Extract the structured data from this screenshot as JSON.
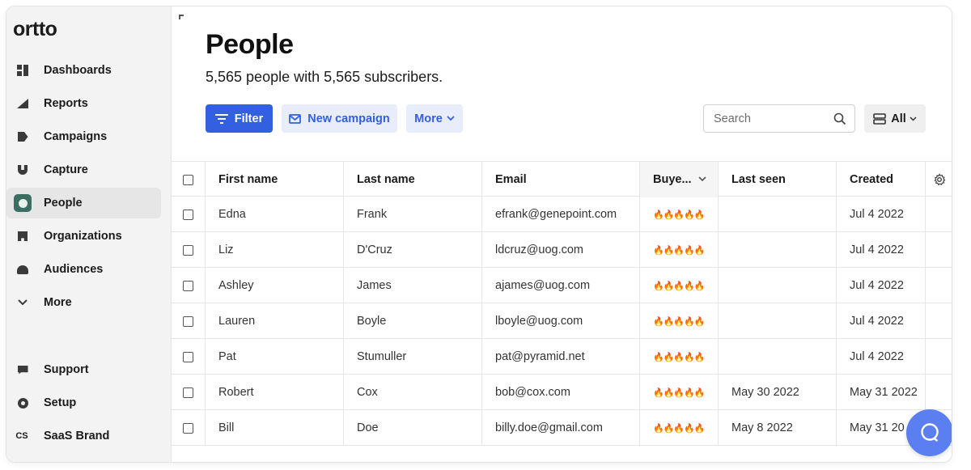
{
  "app": {
    "logo": "ortto"
  },
  "sidebar": {
    "items": [
      {
        "label": "Dashboards",
        "icon": "dashboard-icon"
      },
      {
        "label": "Reports",
        "icon": "reports-icon"
      },
      {
        "label": "Campaigns",
        "icon": "campaigns-icon"
      },
      {
        "label": "Capture",
        "icon": "capture-icon"
      },
      {
        "label": "People",
        "icon": "people-icon",
        "active": true
      },
      {
        "label": "Organizations",
        "icon": "organizations-icon"
      },
      {
        "label": "Audiences",
        "icon": "audiences-icon"
      },
      {
        "label": "More",
        "icon": "chevron-down-icon"
      }
    ],
    "bottom_items": [
      {
        "label": "Support",
        "icon": "support-icon"
      },
      {
        "label": "Setup",
        "icon": "setup-icon"
      },
      {
        "label": "SaaS Brand",
        "icon": "CS"
      }
    ]
  },
  "main": {
    "title": "People",
    "subtitle": "5,565 people with 5,565 subscribers.",
    "toolbar": {
      "filter_label": "Filter",
      "campaign_label": "New campaign",
      "more_label": "More",
      "search_placeholder": "Search",
      "view_label": "All"
    }
  },
  "table": {
    "columns": [
      "First name",
      "Last name",
      "Email",
      "Buye...",
      "Last seen",
      "Created"
    ],
    "rows": [
      {
        "first": "Edna",
        "last": "Frank",
        "email": "efrank@genepoint.com",
        "buyer": "🔥🔥🔥🔥🔥",
        "seen": "",
        "created": "Jul 4 2022"
      },
      {
        "first": "Liz",
        "last": "D'Cruz",
        "email": "ldcruz@uog.com",
        "buyer": "🔥🔥🔥🔥🔥",
        "seen": "",
        "created": "Jul 4 2022"
      },
      {
        "first": "Ashley",
        "last": "James",
        "email": "ajames@uog.com",
        "buyer": "🔥🔥🔥🔥🔥",
        "seen": "",
        "created": "Jul 4 2022"
      },
      {
        "first": "Lauren",
        "last": "Boyle",
        "email": "lboyle@uog.com",
        "buyer": "🔥🔥🔥🔥🔥",
        "seen": "",
        "created": "Jul 4 2022"
      },
      {
        "first": "Pat",
        "last": "Stumuller",
        "email": "pat@pyramid.net",
        "buyer": "🔥🔥🔥🔥🔥",
        "seen": "",
        "created": "Jul 4 2022"
      },
      {
        "first": "Robert",
        "last": "Cox",
        "email": "bob@cox.com",
        "buyer": "🔥🔥🔥🔥🔥",
        "seen": "May 30 2022",
        "created": "May 31 2022"
      },
      {
        "first": "Bill",
        "last": "Doe",
        "email": "billy.doe@gmail.com",
        "buyer": "🔥🔥🔥🔥🔥",
        "seen": "May 8 2022",
        "created": "May 31 20"
      }
    ]
  },
  "colors": {
    "primary": "#3260e0",
    "primary_light": "#e8ecfb",
    "people_icon": "#3a6e63",
    "chat": "#5b7ff0"
  }
}
